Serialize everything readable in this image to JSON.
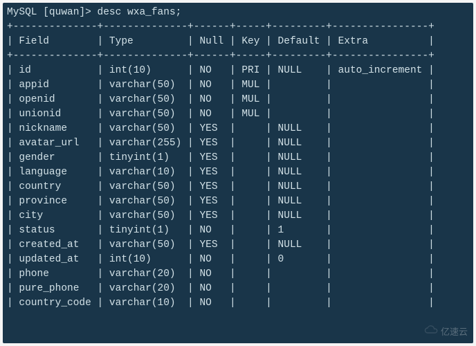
{
  "prompt": {
    "prefix": "MySQL [quwan]> ",
    "command": "desc wxa_fans;"
  },
  "divider_top": "+--------------+--------------+------+-----+---------+----------------+",
  "divider_header": "+--------------+--------------+------+-----+---------+----------------+",
  "divider_bottom": "+--------------+--------------+------+-----+---------+----------------+",
  "headers": {
    "field": "Field",
    "type": "Type",
    "null": "Null",
    "key": "Key",
    "default": "Default",
    "extra": "Extra"
  },
  "rows": [
    {
      "field": "id",
      "type": "int(10)",
      "null": "NO",
      "key": "PRI",
      "default": "NULL",
      "extra": "auto_increment"
    },
    {
      "field": "appid",
      "type": "varchar(50)",
      "null": "NO",
      "key": "MUL",
      "default": "",
      "extra": ""
    },
    {
      "field": "openid",
      "type": "varchar(50)",
      "null": "NO",
      "key": "MUL",
      "default": "",
      "extra": ""
    },
    {
      "field": "unionid",
      "type": "varchar(50)",
      "null": "NO",
      "key": "MUL",
      "default": "",
      "extra": ""
    },
    {
      "field": "nickname",
      "type": "varchar(50)",
      "null": "YES",
      "key": "",
      "default": "NULL",
      "extra": ""
    },
    {
      "field": "avatar_url",
      "type": "varchar(255)",
      "null": "YES",
      "key": "",
      "default": "NULL",
      "extra": ""
    },
    {
      "field": "gender",
      "type": "tinyint(1)",
      "null": "YES",
      "key": "",
      "default": "NULL",
      "extra": ""
    },
    {
      "field": "language",
      "type": "varchar(10)",
      "null": "YES",
      "key": "",
      "default": "NULL",
      "extra": ""
    },
    {
      "field": "country",
      "type": "varchar(50)",
      "null": "YES",
      "key": "",
      "default": "NULL",
      "extra": ""
    },
    {
      "field": "province",
      "type": "varchar(50)",
      "null": "YES",
      "key": "",
      "default": "NULL",
      "extra": ""
    },
    {
      "field": "city",
      "type": "varchar(50)",
      "null": "YES",
      "key": "",
      "default": "NULL",
      "extra": ""
    },
    {
      "field": "status",
      "type": "tinyint(1)",
      "null": "NO",
      "key": "",
      "default": "1",
      "extra": ""
    },
    {
      "field": "created_at",
      "type": "varchar(50)",
      "null": "YES",
      "key": "",
      "default": "NULL",
      "extra": ""
    },
    {
      "field": "updated_at",
      "type": "int(10)",
      "null": "NO",
      "key": "",
      "default": "0",
      "extra": ""
    },
    {
      "field": "phone",
      "type": "varchar(20)",
      "null": "NO",
      "key": "",
      "default": "",
      "extra": ""
    },
    {
      "field": "pure_phone",
      "type": "varchar(20)",
      "null": "NO",
      "key": "",
      "default": "",
      "extra": ""
    },
    {
      "field": "country_code",
      "type": "varchar(10)",
      "null": "NO",
      "key": "",
      "default": "",
      "extra": ""
    }
  ],
  "watermark": "亿速云"
}
